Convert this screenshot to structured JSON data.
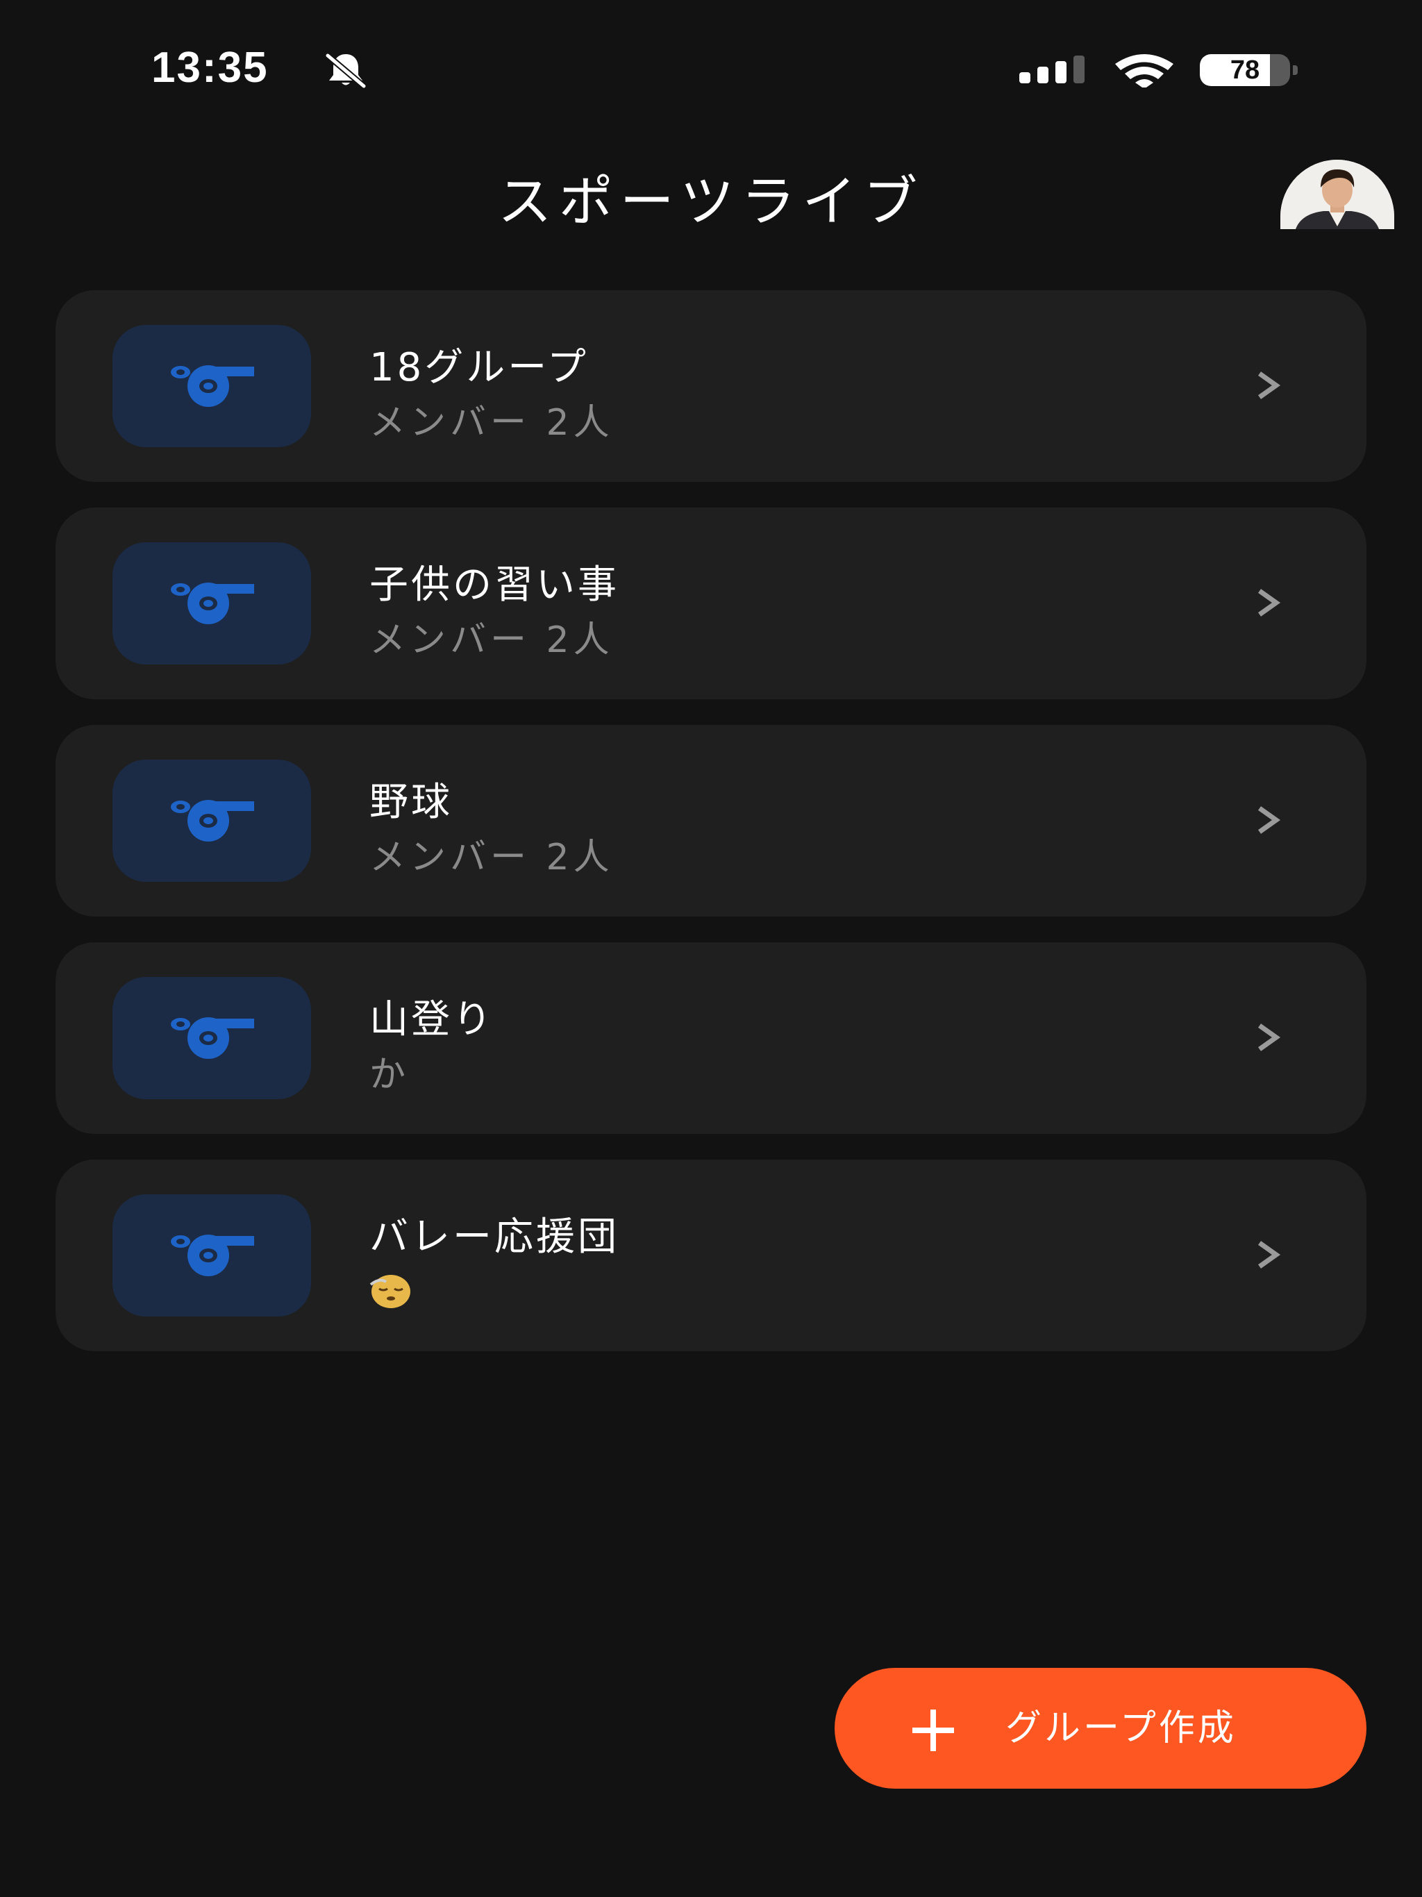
{
  "status_bar": {
    "time": "13:35",
    "battery_level": "78",
    "battery_fraction": 0.78,
    "signal_bars_active": 3,
    "signal_bars_total": 4,
    "icons": [
      "bell-slash-icon",
      "signal-icon",
      "wifi-icon",
      "battery-icon"
    ]
  },
  "header": {
    "title": "スポーツライブ",
    "avatar_icon": "user-avatar"
  },
  "groups": [
    {
      "name": "18グループ",
      "subtitle": "メンバー 2人",
      "icon": "whistle-icon"
    },
    {
      "name": "子供の習い事",
      "subtitle": "メンバー 2人",
      "icon": "whistle-icon"
    },
    {
      "name": "野球",
      "subtitle": "メンバー 2人",
      "icon": "whistle-icon"
    },
    {
      "name": "山登り",
      "subtitle": "か",
      "icon": "whistle-icon"
    },
    {
      "name": "バレー応援団",
      "subtitle_emoji": "face-exhaling-icon",
      "icon": "whistle-icon"
    }
  ],
  "fab": {
    "label": "グループ作成",
    "icon": "plus-icon"
  },
  "colors": {
    "background": "#121212",
    "card": "#1f1f1f",
    "icon_box": "#1b2b45",
    "whistle": "#1e63c7",
    "subtitle": "#8a8a8a",
    "chevron": "#9a9a9a",
    "accent": "#ff5722"
  }
}
